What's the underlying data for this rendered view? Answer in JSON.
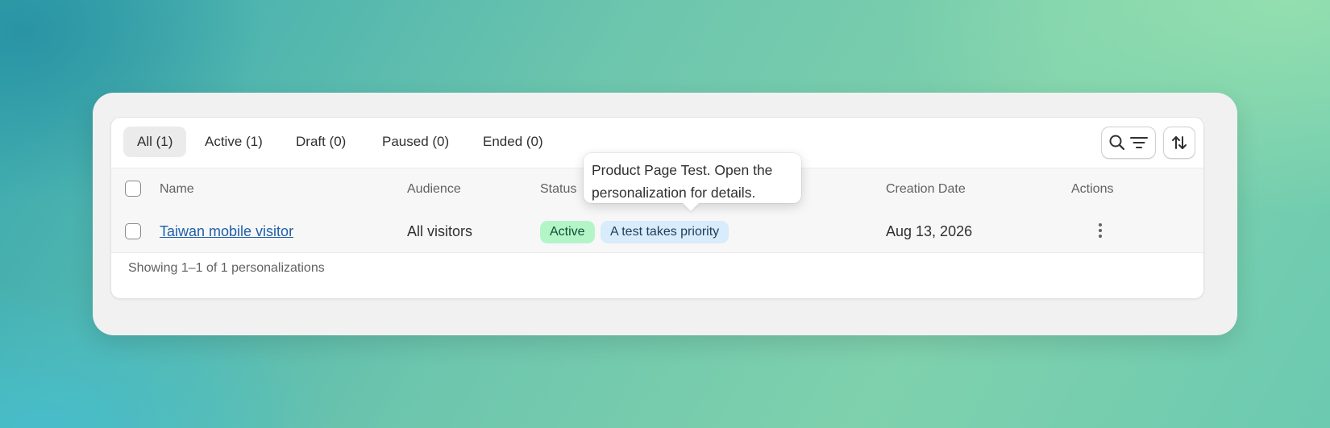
{
  "tabs": [
    {
      "label": "All (1)",
      "selected": true
    },
    {
      "label": "Active (1)",
      "selected": false
    },
    {
      "label": "Draft (0)",
      "selected": false
    },
    {
      "label": "Paused (0)",
      "selected": false
    },
    {
      "label": "Ended (0)",
      "selected": false
    }
  ],
  "toolbar": {
    "search_filter_icons": [
      "search-icon",
      "filter-lines-icon"
    ],
    "sort_icon": "sort-arrows-icon"
  },
  "table": {
    "headers": {
      "name": "Name",
      "audience": "Audience",
      "status": "Status",
      "creation_date": "Creation Date",
      "actions": "Actions"
    },
    "rows": [
      {
        "name": "Taiwan mobile visitor",
        "audience": "All visitors",
        "status_badge": "Active",
        "info_badge": "A test takes priority",
        "creation_date": "Aug 13, 2026",
        "actions_icon": "more-vertical-icon"
      }
    ]
  },
  "tooltip": {
    "text": "Product Page Test. Open the personalization for details."
  },
  "footer": {
    "summary": "Showing 1–1 of 1 personalizations"
  },
  "colors": {
    "active_badge_bg": "#b4f5c8",
    "info_badge_bg": "#d8ecfb",
    "link": "#1f5fa8"
  }
}
